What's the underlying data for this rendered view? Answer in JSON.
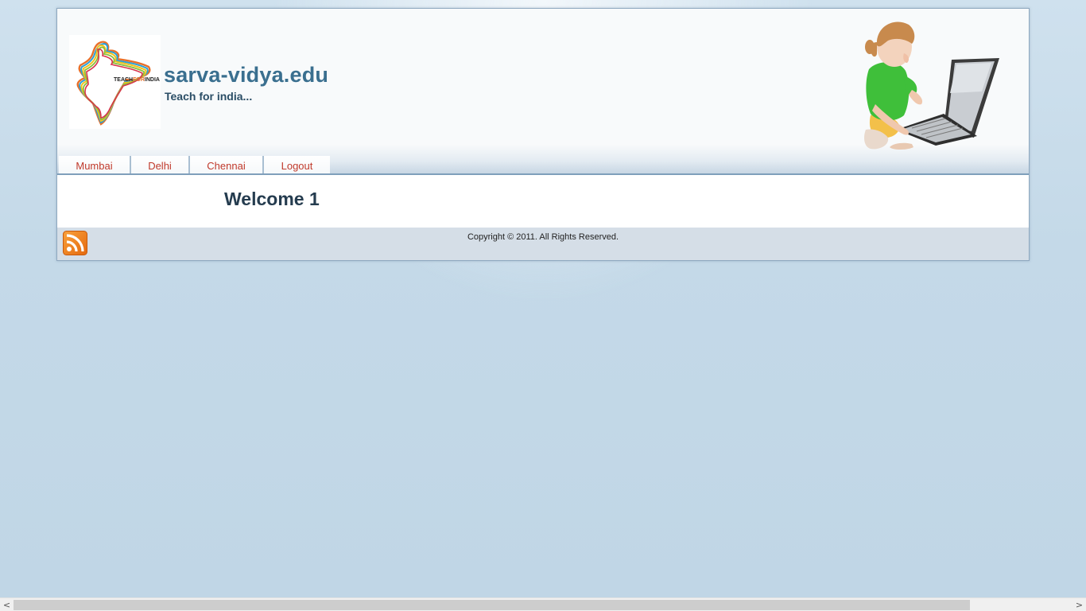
{
  "header": {
    "logo_text": "TEACHFORINDIA",
    "site_title": "sarva-vidya.edu",
    "slogan": "Teach for india..."
  },
  "nav": {
    "tabs": [
      {
        "label": "Mumbai"
      },
      {
        "label": "Delhi"
      },
      {
        "label": "Chennai"
      },
      {
        "label": "Logout"
      }
    ]
  },
  "content": {
    "heading": "Welcome 1"
  },
  "footer": {
    "copyright": "Copyright © 2011. All Rights Reserved.",
    "rss_icon": "rss-feed-icon"
  },
  "scrollbar": {
    "left_arrow": "<",
    "right_arrow": ">"
  },
  "colors": {
    "title": "#3a6f8f",
    "tab_text": "#c0392b",
    "background": "#c3d9e8"
  }
}
